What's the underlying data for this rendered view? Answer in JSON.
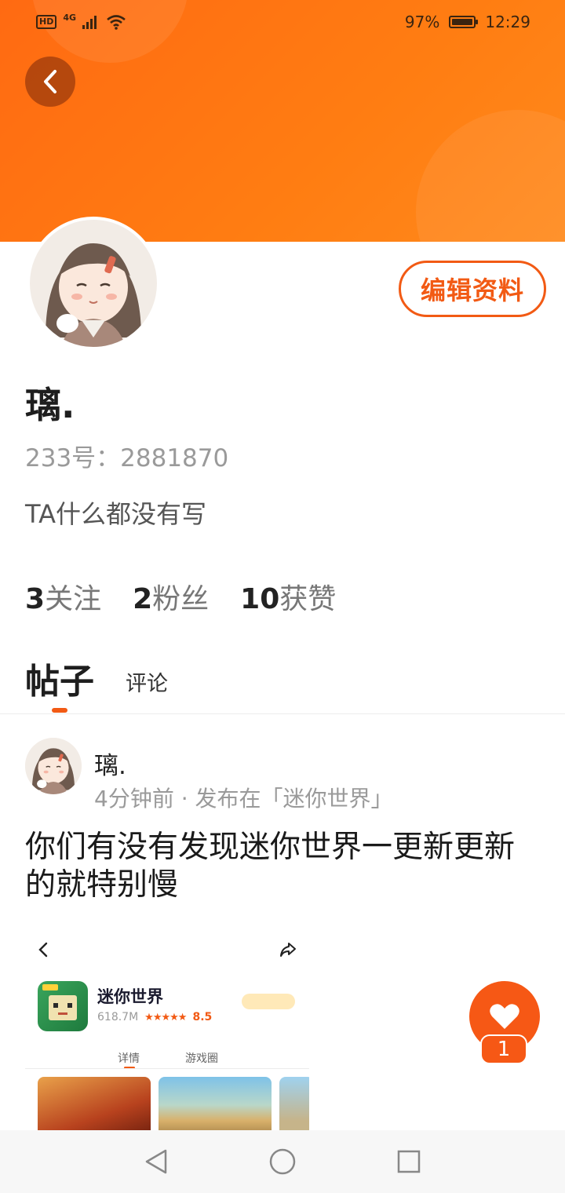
{
  "status_bar": {
    "hd": "HD",
    "network": "4G",
    "battery": "97%",
    "time": "12:29"
  },
  "profile": {
    "nickname": "璃.",
    "account_id": "233号：2881870",
    "bio": "TA什么都没有写",
    "edit_button": "编辑资料"
  },
  "stats": [
    {
      "num": "3",
      "label": "关注"
    },
    {
      "num": "2",
      "label": "粉丝"
    },
    {
      "num": "10",
      "label": "获赞"
    }
  ],
  "tabs": {
    "posts": "帖子",
    "comments": "评论"
  },
  "post": {
    "author": "璃.",
    "meta": "4分钟前 · 发布在「迷你世界」",
    "text": "你们有没有发现迷你世界一更新更新的就特别慢",
    "screenshot": {
      "app_name": "迷你世界",
      "downloads": "618.7M",
      "rating": "8.5",
      "tab_detail": "详情",
      "tab_circle": "游戏圈"
    }
  },
  "like": {
    "count": "1"
  },
  "colors": {
    "accent": "#f25a14",
    "header_start": "#ff6a12",
    "header_end": "#ff8a1c"
  }
}
